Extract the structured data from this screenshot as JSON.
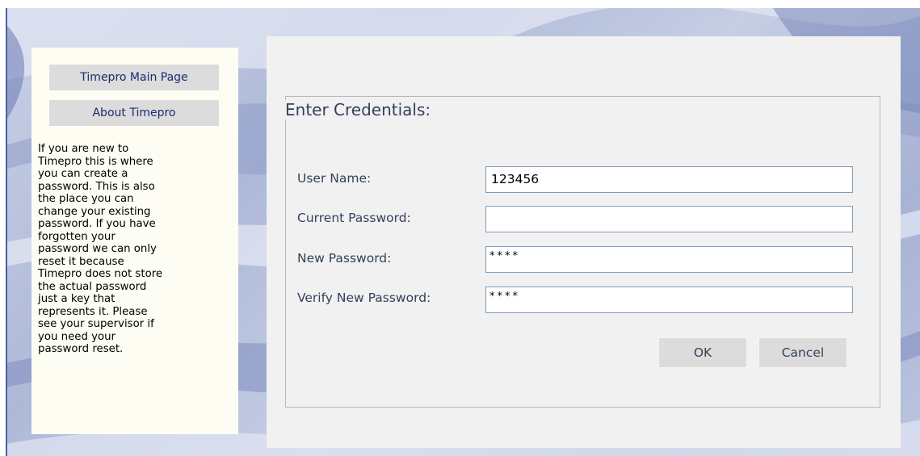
{
  "sidebar": {
    "main_page_label": "Timepro Main Page",
    "about_label": "About Timepro",
    "help_text": "If you are new to\nTimepro this is where\nyou can create a\npassword. This is also\nthe place you can\nchange your existing\npassword. If you have\nforgotten your\npassword we can only\nreset it because\nTimepro does not store\nthe actual password\njust a key that\nrepresents it. Please\nsee your supervisor if\nyou need your\npassword reset."
  },
  "form": {
    "legend": "Enter Credentials:",
    "user_name_label": "User Name:",
    "user_name_value": "123456",
    "current_password_label": "Current Password:",
    "current_password_value": "",
    "new_password_label": "New Password:",
    "new_password_value": "****",
    "verify_password_label": "Verify New Password:",
    "verify_password_value": "****",
    "ok_label": "OK",
    "cancel_label": "Cancel"
  },
  "colors": {
    "background_blue": "#aeb9d8",
    "sidebar_bg": "#fdfdf3",
    "panel_bg": "#f1f1f1",
    "button_bg": "#dcdcdc",
    "label_text": "#33415c",
    "link_text": "#1e2a6e"
  }
}
